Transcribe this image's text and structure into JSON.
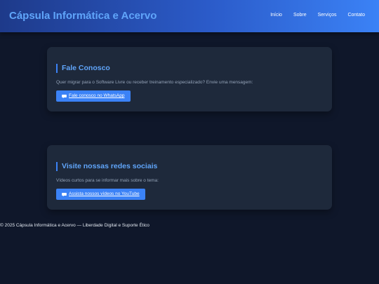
{
  "header": {
    "brand": "Cápsula Informática e Acervo",
    "nav": [
      "Início",
      "Sobre",
      "Serviços",
      "Contato"
    ]
  },
  "contact": {
    "title": "Fale Conosco",
    "text": "Quer migrar para o Software Livre ou receber treinamento especializado? Envie uma mensagem:",
    "button_label": "Fale conosco no WhatsApp",
    "button_icon": "speech-bubble-icon"
  },
  "social": {
    "title": "Visite nossas redes sociais",
    "text": "Vídeos curtos para se informar mais sobre o tema:",
    "button_label": "Assista nossos vídeos no YouTube",
    "button_icon": "speech-bubble-icon"
  },
  "footer": {
    "text": "© 2025 Cápsula Informática e Acervo — Liberdade Digital e Suporte Ético"
  },
  "colors": {
    "background": "#0f172a",
    "card": "#1e293b",
    "accent": "#3b82f6",
    "title": "#60a5fa"
  }
}
